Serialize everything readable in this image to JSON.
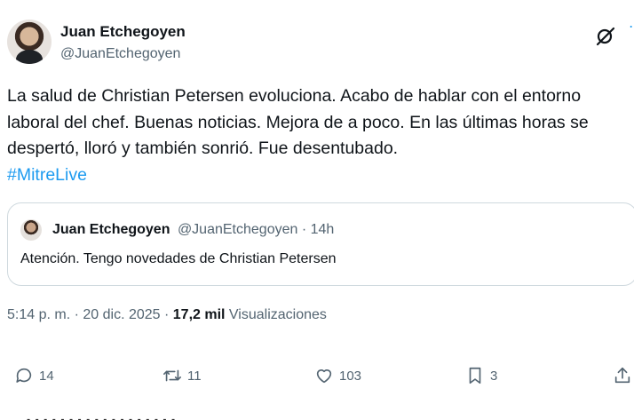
{
  "author": {
    "name": "Juan Etchegoyen",
    "handle": "@JuanEtchegoyen"
  },
  "tweet": {
    "text": "La salud de Christian Petersen evoluciona. Acabo de hablar con el entorno laboral del chef. Buenas noticias. Mejora de a poco. En las últimas horas se despertó, lloró y también sonrió. Fue desentubado.",
    "hashtag": "#MitreLive"
  },
  "quote": {
    "name": "Juan Etchegoyen",
    "meta": "@JuanEtchegoyen · 14h",
    "text": "Atención. Tengo novedades de Christian Petersen"
  },
  "meta": {
    "time": "5:14 p. m. · 20 dic. 2025 · ",
    "views_count": "17,2 mil",
    "views_label": " Visualizaciones"
  },
  "actions": {
    "replies": "14",
    "retweets": "11",
    "likes": "103",
    "bookmarks": "3"
  },
  "colors": {
    "link": "#1d9bf0",
    "secondary_text": "#536471",
    "border": "#cfd9de"
  },
  "icons": [
    "grok-icon",
    "more-icon",
    "reply-icon",
    "retweet-icon",
    "heart-icon",
    "bookmark-icon",
    "share-icon"
  ]
}
